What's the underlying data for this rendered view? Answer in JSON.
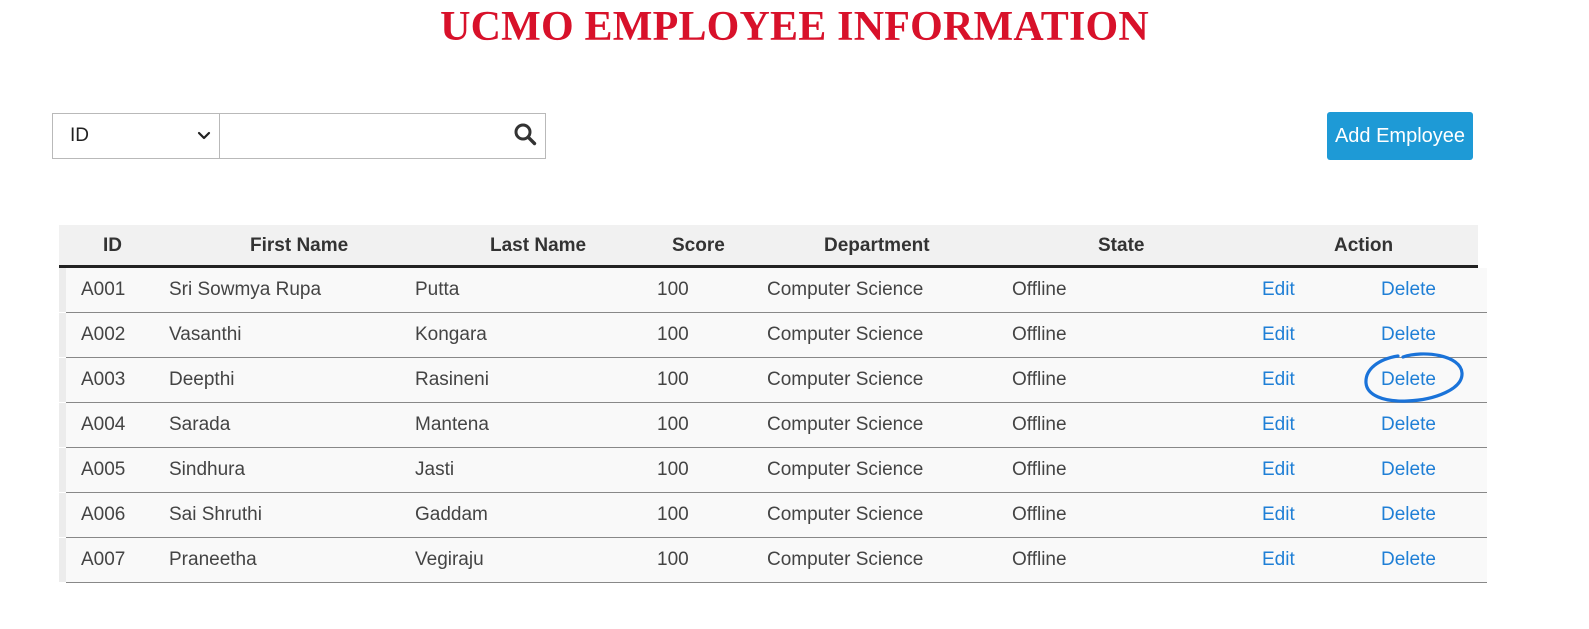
{
  "title": "UCMO EMPLOYEE INFORMATION",
  "search": {
    "field_selected": "ID",
    "value": "",
    "placeholder": ""
  },
  "add_button_label": "Add Employee",
  "columns": [
    "ID",
    "First Name",
    "Last Name",
    "Score",
    "Department",
    "State",
    "Action"
  ],
  "rows": [
    {
      "id": "A001",
      "first": "Sri Sowmya Rupa",
      "last": "Putta",
      "score": "100",
      "dept": "Computer Science",
      "state": "Offline",
      "edit": "Edit",
      "delete": "Delete"
    },
    {
      "id": "A002",
      "first": "Vasanthi",
      "last": "Kongara",
      "score": "100",
      "dept": "Computer Science",
      "state": "Offline",
      "edit": "Edit",
      "delete": "Delete"
    },
    {
      "id": "A003",
      "first": "Deepthi",
      "last": "Rasineni",
      "score": "100",
      "dept": "Computer Science",
      "state": "Offline",
      "edit": "Edit",
      "delete": "Delete"
    },
    {
      "id": "A004",
      "first": "Sarada",
      "last": "Mantena",
      "score": "100",
      "dept": "Computer Science",
      "state": "Offline",
      "edit": "Edit",
      "delete": "Delete"
    },
    {
      "id": "A005",
      "first": "Sindhura",
      "last": "Jasti",
      "score": "100",
      "dept": "Computer Science",
      "state": "Offline",
      "edit": "Edit",
      "delete": "Delete"
    },
    {
      "id": "A006",
      "first": "Sai Shruthi",
      "last": "Gaddam",
      "score": "100",
      "dept": "Computer Science",
      "state": "Offline",
      "edit": "Edit",
      "delete": "Delete"
    },
    {
      "id": "A007",
      "first": "Praneetha",
      "last": "Vegiraju",
      "score": "100",
      "dept": "Computer Science",
      "state": "Offline",
      "edit": "Edit",
      "delete": "Delete"
    }
  ],
  "colors": {
    "title": "#d8112a",
    "button": "#1e9ad6",
    "link": "#1f7fd6",
    "annotation": "#1a73d9"
  },
  "icons": {
    "search": "search-icon",
    "dropdown": "chevron-down-icon"
  }
}
